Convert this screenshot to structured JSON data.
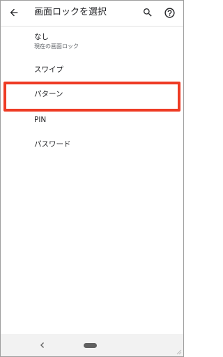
{
  "app_bar": {
    "title": "画面ロックを選択",
    "back_icon": "arrow-back-icon",
    "search_icon": "search-icon",
    "help_icon": "help-circle-icon"
  },
  "options": {
    "none": {
      "label": "なし",
      "subtitle": "現在の画面ロック"
    },
    "swipe": {
      "label": "スワイプ"
    },
    "pattern": {
      "label": "パターン",
      "highlighted": true
    },
    "pin": {
      "label": "PIN"
    },
    "password": {
      "label": "パスワード"
    }
  },
  "colors": {
    "highlight": "#ee3b24",
    "text_primary": "#202124",
    "text_secondary": "#5f6368",
    "navbar_bg": "#f2f2f2"
  },
  "nav_bar": {
    "back_icon": "chevron-left-icon",
    "home_icon": "home-pill-icon"
  }
}
